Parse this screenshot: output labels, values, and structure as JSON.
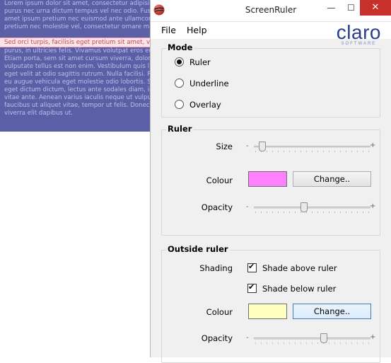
{
  "document": {
    "lines_above": [
      "Lorem ipsum dolor sit amet, consectetur adipisicing",
      "purus nec urna dictum tempus vel nec odio. Fusce",
      "amet ipsum pretium nec euismod ante ullamcorper",
      "pretium nec molestie vel, consectetur ornare mi."
    ],
    "ruler_line": "Sed orci turpis, facilisis eget pretium sit amet, va",
    "lines_below": [
      "purus, in ultricies felis. Vivamus volutpat eros eu",
      "Etiam porta, sem sit amet cursum viverra, dolor e",
      "vulputate tellus est non enim. Vestibulum quis l",
      "eget velit at odio sagittis rutrum. Nulla facilisi. Pe",
      "eu augue vehicula eget molestie odio lobortis. Su",
      "eget dictum dictum, lectus ante sodales diam, in",
      "vitae ante. Aenean varius iaculis neque ut vulpu",
      "faucibus ut aliquet vitae, tempor ut felis. Donec",
      "viverra elit dapibus ut."
    ]
  },
  "window": {
    "title": "ScreenRuler",
    "buttons": {
      "minimize": "—",
      "maximize": "☐",
      "close": "✕"
    }
  },
  "menu": {
    "file": "File",
    "help": "Help"
  },
  "logo": {
    "word": "claro",
    "sub": "SOFTWARE"
  },
  "mode": {
    "title": "Mode",
    "options": [
      {
        "label": "Ruler",
        "selected": true
      },
      {
        "label": "Underline",
        "selected": false
      },
      {
        "label": "Overlay",
        "selected": false
      }
    ]
  },
  "ruler": {
    "title": "Ruler",
    "size_label": "Size",
    "size_value": 0.07,
    "colour_label": "Colour",
    "colour": "#ff80ff",
    "change_label": "Change..",
    "opacity_label": "Opacity",
    "opacity_value": 0.43
  },
  "outside": {
    "title": "Outside ruler",
    "shading_label": "Shading",
    "shade_above": {
      "label": "Shade above ruler",
      "checked": true
    },
    "shade_below": {
      "label": "Shade below ruler",
      "checked": true
    },
    "colour_label": "Colour",
    "colour": "#ffffc0",
    "change_label": "Change..",
    "opacity_label": "Opacity",
    "opacity_value": 0.6
  },
  "slider_marks": {
    "minus": "-",
    "plus": "+"
  }
}
